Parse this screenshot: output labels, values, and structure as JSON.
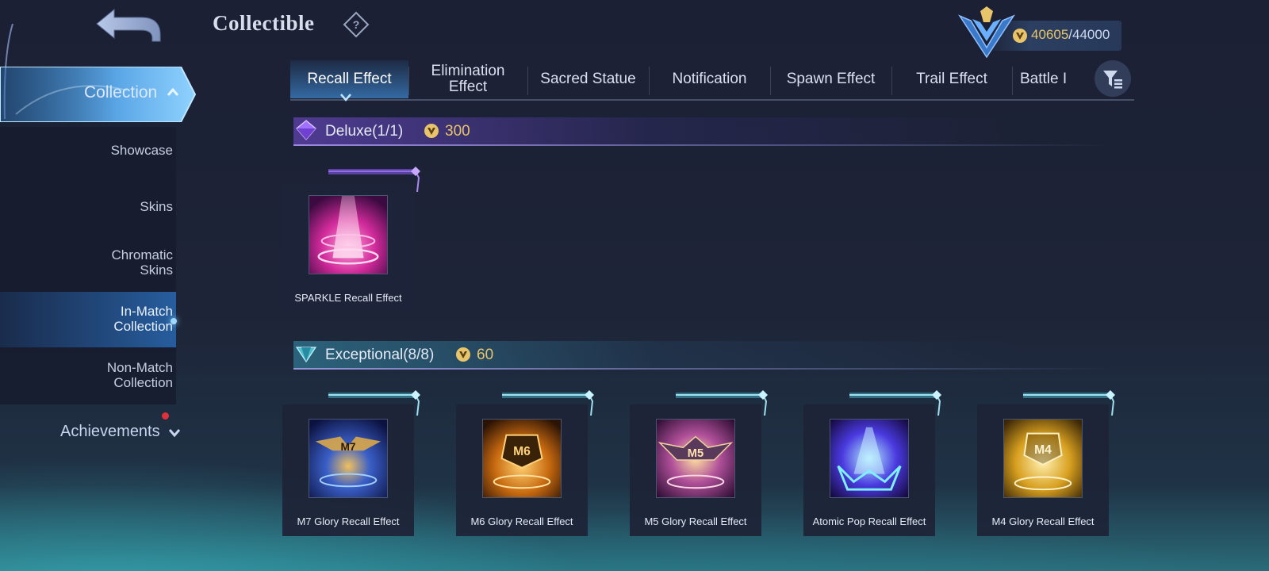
{
  "header": {
    "title": "Collectible",
    "help_icon": "question-diamond-icon",
    "back_icon": "back-arrow-icon"
  },
  "currency": {
    "current": "40605",
    "separator": "/",
    "max": "44000",
    "icon": "collection-coin-icon",
    "color": "#e8c56a"
  },
  "sidebar": {
    "collection_label": "Collection",
    "items": [
      {
        "label": "Showcase"
      },
      {
        "label": "Skins"
      },
      {
        "label": "Chromatic Skins",
        "line1": "Chromatic",
        "line2": "Skins"
      },
      {
        "label": "In-Match Collection",
        "line1": "In-Match",
        "line2": "Collection",
        "active": true
      },
      {
        "label": "Non-Match Collection",
        "line1": "Non-Match",
        "line2": "Collection"
      }
    ],
    "achievements_label": "Achievements"
  },
  "tabs": [
    {
      "label": "Recall Effect",
      "active": true
    },
    {
      "label": "Elimination Effect",
      "line1": "Elimination",
      "line2": "Effect"
    },
    {
      "label": "Sacred Statue"
    },
    {
      "label": "Notification"
    },
    {
      "label": "Spawn Effect"
    },
    {
      "label": "Trail Effect"
    },
    {
      "label": "Battle I"
    }
  ],
  "sections": [
    {
      "name": "Deluxe",
      "count": "(1/1)",
      "value": "300",
      "accent": "#8a5cf0",
      "items": [
        {
          "name": "SPARKLE Recall Effect"
        }
      ]
    },
    {
      "name": "Exceptional",
      "count": "(8/8)",
      "value": "60",
      "accent": "#5cc8d8",
      "items": [
        {
          "name": "M7 Glory Recall Effect",
          "badge": "M7"
        },
        {
          "name": "M6 Glory Recall Effect",
          "badge": "M6"
        },
        {
          "name": "M5 Glory Recall Effect",
          "badge": "M5"
        },
        {
          "name": "Atomic Pop Recall Effect"
        },
        {
          "name": "M4 Glory Recall Effect",
          "badge": "M4"
        }
      ]
    }
  ]
}
